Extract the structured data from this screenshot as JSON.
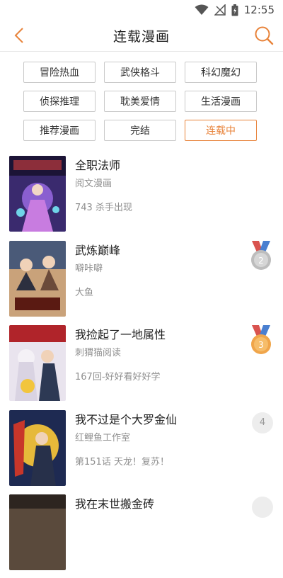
{
  "status_bar": {
    "time": "12:55"
  },
  "header": {
    "title": "连载漫画"
  },
  "tags": [
    {
      "label": "冒险热血",
      "active": false
    },
    {
      "label": "武侠格斗",
      "active": false
    },
    {
      "label": "科幻魔幻",
      "active": false
    },
    {
      "label": "侦探推理",
      "active": false
    },
    {
      "label": "耽美爱情",
      "active": false
    },
    {
      "label": "生活漫画",
      "active": false
    },
    {
      "label": "推荐漫画",
      "active": false
    },
    {
      "label": "完结",
      "active": false
    },
    {
      "label": "连载中",
      "active": true
    }
  ],
  "comics": [
    {
      "title": "全职法师",
      "author": "阅文漫画",
      "desc": "743 杀手出现",
      "rank": ""
    },
    {
      "title": "武炼巅峰",
      "author": "噼咔噼",
      "desc": "大鱼",
      "rank": "2"
    },
    {
      "title": "我捡起了一地属性",
      "author": "刺猬猫阅读",
      "desc": "167回-好好看好好学",
      "rank": "3"
    },
    {
      "title": "我不过是个大罗金仙",
      "author": "红鲤鱼工作室",
      "desc": "第151话 天龙！复苏！",
      "rank": "4"
    },
    {
      "title": "我在末世搬金砖",
      "author": "",
      "desc": "",
      "rank": ""
    }
  ],
  "colors": {
    "accent": "#e8833a",
    "silver": "#b9b9b9",
    "bronze": "#f0a54a"
  }
}
